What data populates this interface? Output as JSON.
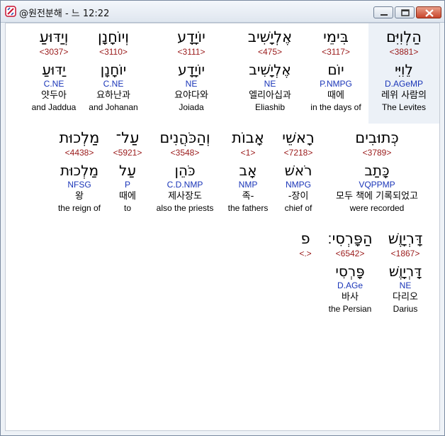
{
  "window": {
    "title": "@원전분해 - 느 12:22"
  },
  "rows": [
    [
      {
        "heb": "הַלְוִיִּם",
        "strong": "<3881>",
        "lemma": "לֵוִיִּי",
        "morph": "D.AGeMP",
        "kor": "레위 사람의",
        "eng": "The Levites",
        "highlight": true
      },
      {
        "heb": "בִּימֵי",
        "strong": "<3117>",
        "lemma": "יוֹם",
        "morph": "P.NMPG",
        "kor": "때에",
        "eng": "in the days of"
      },
      {
        "heb": "אֶלְיָשִׁיב",
        "strong": "<475>",
        "lemma": "אֶלְיָשִׁיב",
        "morph": "NE",
        "kor": "엘리아십과",
        "eng": "Eliashib"
      },
      {
        "heb": "יוֹיָדָע",
        "strong": "<3111>",
        "lemma": "יוֹיָדָע",
        "morph": "NE",
        "kor": "요야다와",
        "eng": "Joiada"
      },
      {
        "heb": "וְיוֹחָנָן",
        "strong": "<3110>",
        "lemma": "יוֹחָנָן",
        "morph": "C.NE",
        "kor": "요하난과",
        "eng": "and Johanan"
      },
      {
        "heb": "וְיַדּוּעַ",
        "strong": "<3037>",
        "lemma": "יַדּוּעַ",
        "morph": "C.NE",
        "kor": "얏두아",
        "eng": "and Jaddua"
      }
    ],
    [
      {
        "heb": "כְּתוּבִים",
        "strong": "<3789>",
        "lemma": "כָּתַב",
        "morph": "VQPPMP",
        "kor": "모두 책에 기록되었고",
        "eng": "were recorded"
      },
      {
        "heb": "רָאשֵׁי",
        "strong": "<7218>",
        "lemma": "רֹאשׁ",
        "morph": "NMPG",
        "kor": "-장이",
        "eng": "chief of"
      },
      {
        "heb": "אָבוֹת",
        "strong": "<1>",
        "lemma": "אָב",
        "morph": "NMP",
        "kor": "족-",
        "eng": "the fathers"
      },
      {
        "heb": "וְהַכֹּהֲנִים",
        "strong": "<3548>",
        "lemma": "כֹּהֵן",
        "morph": "C.D.NMP",
        "kor": "제사장도",
        "eng": "also the priests"
      },
      {
        "heb": "עַל־",
        "strong": "<5921>",
        "lemma": "עַל",
        "morph": "P",
        "kor": "때에",
        "eng": "to"
      },
      {
        "heb": "מַלְכוּת",
        "strong": "<4438>",
        "lemma": "מַלְכוּת",
        "morph": "NFSG",
        "kor": "왕",
        "eng": "the reign of"
      }
    ],
    [
      {
        "heb": "דָּרְיָוֶשׁ",
        "strong": "<1867>",
        "lemma": "דָּרְיָוֶשׁ",
        "morph": "NE",
        "kor": "다리오",
        "eng": "Darius"
      },
      {
        "heb": "הַפָּרְסִי׃",
        "strong": "<6542>",
        "lemma": "פָּרְסִי",
        "morph": "D.AGe",
        "kor": "바사",
        "eng": "the Persian"
      },
      {
        "heb": "פ",
        "strong": "<.>",
        "lemma": "",
        "morph": "",
        "kor": "",
        "eng": ""
      }
    ]
  ]
}
